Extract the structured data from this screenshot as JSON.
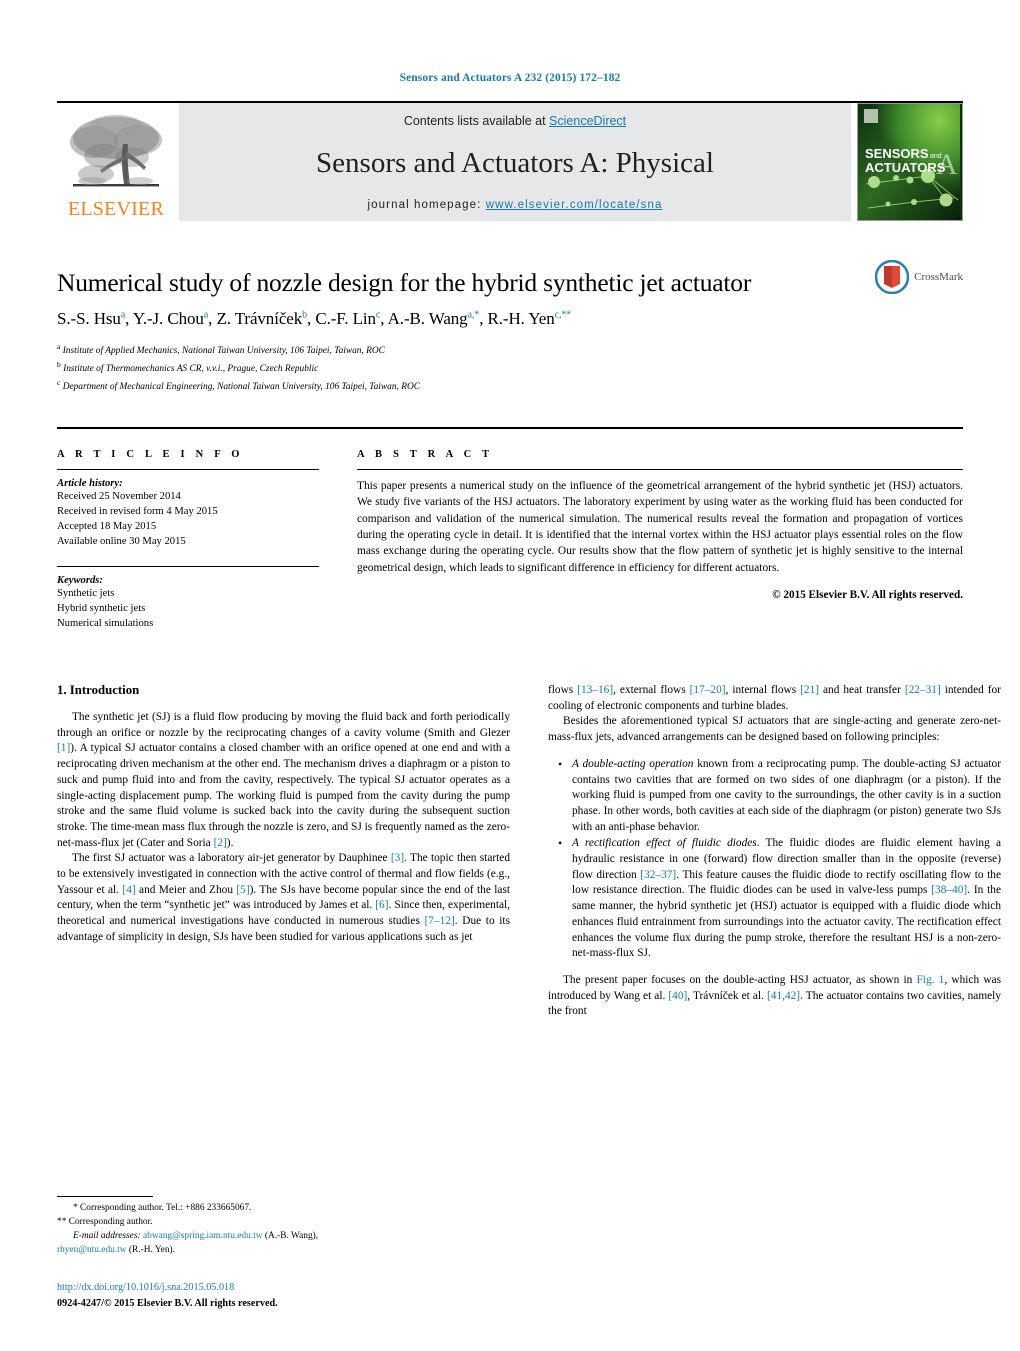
{
  "running_head": "Sensors and Actuators A 232 (2015) 172–182",
  "header": {
    "contents_prefix": "Contents lists available at ",
    "sciencedirect": "ScienceDirect",
    "journal_title": "Sensors and Actuators A: Physical",
    "homepage_prefix": "journal homepage: ",
    "homepage_url": "www.elsevier.com/locate/sna",
    "publisher": "ELSEVIER",
    "cover_line1": "SENSORS",
    "cover_and": "and",
    "cover_line2": "ACTUATORS",
    "cover_letter": "A"
  },
  "title": "Numerical study of nozzle design for the hybrid synthetic jet actuator",
  "crossmark_label": "CrossMark",
  "authors_html": "S.-S. Hsu<sup>a</sup>, Y.-J. Chou<sup>a</sup>, Z. Trávníček<sup>b</sup>, C.-F. Lin<sup>c</sup>, A.-B. Wang<sup>a,<span class=\"star\">*</span></sup>, R.-H. Yen<sup>c,<span class=\"star\">**</span></sup>",
  "affiliations": [
    {
      "marker": "a",
      "text": "Institute of Applied Mechanics, National Taiwan University, 106 Taipei, Taiwan, ROC"
    },
    {
      "marker": "b",
      "text": "Institute of Thermomechanics AS CR, v.v.i., Prague, Czech Republic"
    },
    {
      "marker": "c",
      "text": "Department of Mechanical Engineering, National Taiwan University, 106 Taipei, Taiwan, ROC"
    }
  ],
  "article_info": {
    "heading": "A R T I C L E   I N F O",
    "history_label": "Article history:",
    "history": [
      "Received 25 November 2014",
      "Received in revised form 4 May 2015",
      "Accepted 18 May 2015",
      "Available online 30 May 2015"
    ],
    "keywords_label": "Keywords:",
    "keywords": [
      "Synthetic jets",
      "Hybrid synthetic jets",
      "Numerical simulations"
    ]
  },
  "abstract": {
    "heading": "A B S T R A C T",
    "text": "This paper presents a numerical study on the influence of the geometrical arrangement of the hybrid synthetic jet (HSJ) actuators. We study five variants of the HSJ actuators. The laboratory experiment by using water as the working fluid has been conducted for comparison and validation of the numerical simulation. The numerical results reveal the formation and propagation of vortices during the operating cycle in detail. It is identified that the internal vortex within the HSJ actuator plays essential roles on the flow mass exchange during the operating cycle. Our results show that the flow pattern of synthetic jet is highly sensitive to the internal geometrical design, which leads to significant difference in efficiency for different actuators.",
    "copyright": "© 2015 Elsevier B.V. All rights reserved."
  },
  "body": {
    "section_number_title": "1.  Introduction",
    "left_para_1_html": "The synthetic jet (SJ) is a fluid flow producing by moving the fluid back and forth periodically through an orifice or nozzle by the reciprocating changes of a cavity volume (Smith and Glezer <span class=\"ref\">[1]</span>). A typical SJ actuator contains a closed chamber with an orifice opened at one end and with a reciprocating driven mechanism at the other end. The mechanism drives a diaphragm or a piston to suck and pump fluid into and from the cavity, respectively. The typical SJ actuator operates as a single-acting displacement pump. The working fluid is pumped from the cavity during the pump stroke and the same fluid volume is sucked back into the cavity during the subsequent suction stroke. The time-mean mass flux through the nozzle is zero, and SJ is frequently named as the zero-net-mass-flux jet (Cater and Soria <span class=\"ref\">[2]</span>).",
    "left_para_2_html": "The first SJ actuator was a laboratory air-jet generator by Dauphinee <span class=\"ref\">[3]</span>. The topic then started to be extensively investigated in connection with the active control of thermal and flow fields (e.g., Yassour et al. <span class=\"ref\">[4]</span> and Meier and Zhou <span class=\"ref\">[5]</span>). The SJs have become popular since the end of the last century, when the term “synthetic jet” was introduced by James et al. <span class=\"ref\">[6]</span>. Since then, experimental, theoretical and numerical investigations have conducted in numerous studies <span class=\"ref\">[7–12]</span>. Due to its advantage of simplicity in design, SJs have been studied for various applications such as jet",
    "right_para_1_html": "flows <span class=\"ref\">[13–16]</span>, external flows <span class=\"ref\">[17–20]</span>, internal flows <span class=\"ref\">[21]</span> and heat transfer <span class=\"ref\">[22–31]</span> intended for cooling of electronic components and turbine blades.",
    "right_para_2_html": "Besides the aforementioned typical SJ actuators that are single-acting and generate zero-net-mass-flux jets, advanced arrangements can be designed based on following principles:",
    "bullets_html": [
      "<i>A double-acting operation</i> known from a reciprocating pump. The double-acting SJ actuator contains two cavities that are formed on two sides of one diaphragm (or a piston). If the working fluid is pumped from one cavity to the surroundings, the other cavity is in a suction phase. In other words, both cavities at each side of the diaphragm (or piston) generate two SJs with an anti-phase behavior.",
      "<i>A rectification effect of fluidic diodes</i>. The fluidic diodes are fluidic element having a hydraulic resistance in one (forward) flow direction smaller than in the opposite (reverse) flow direction <span class=\"ref\">[32–37]</span>. This feature causes the fluidic diode to rectify oscillating flow to the low resistance direction. The fluidic diodes can be used in valve-less pumps <span class=\"ref\">[38–40]</span>. In the same manner, the hybrid synthetic jet (HSJ) actuator is equipped with a fluidic diode which enhances fluid entrainment from surroundings into the actuator cavity. The rectification effect enhances the volume flux during the pump stroke, therefore the resultant HSJ is a non-zero-net-mass-flux SJ."
    ],
    "right_para_3_html": "The present paper focuses on the double-acting HSJ actuator, as shown in <span class=\"ref\">Fig. 1</span>, which was introduced by Wang et al. <span class=\"ref\">[40]</span>, Trávníček et al. <span class=\"ref\">[41,42]</span>. The actuator contains two cavities, namely the front"
  },
  "footnotes": {
    "line1_html": "<span class=\"ind\">*  Corresponding author. Tel.: +886 233665067.</span>",
    "line2_html": "** Corresponding author.",
    "line3_html": "<span class=\"ind\"><span class=\"lbl\">E-mail addresses:</span> <span class=\"link\">abwang@spring.iam.ntu.edu.tw</span> (A.-B. Wang),</span>",
    "line4_html": "<span class=\"link\">rhyen@ntu.edu.tw</span> (R.-H. Yen)."
  },
  "doi_block": {
    "doi": "http://dx.doi.org/10.1016/j.sna.2015.05.018",
    "issn": "0924-4247/© 2015 Elsevier B.V. All rights reserved."
  }
}
